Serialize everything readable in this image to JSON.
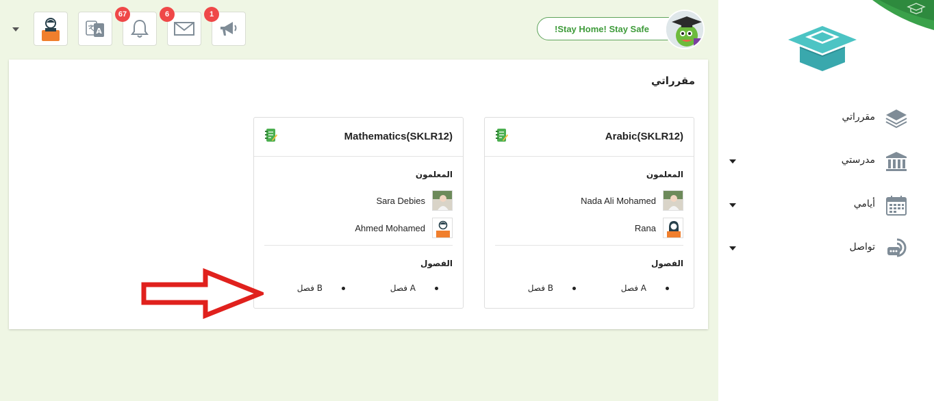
{
  "header": {
    "badges": {
      "notifications": "67",
      "messages": "6",
      "announcements": "1"
    },
    "stay_home": "!Stay Home! Stay Safe"
  },
  "main": {
    "title": "مقرراتي",
    "courses": [
      {
        "title": "Arabic(SKLR12)",
        "teachers_label": "المعلمون",
        "teachers": [
          {
            "name": "Nada Ali Mohamed"
          },
          {
            "name": "Rana"
          }
        ],
        "classes_label": "الفصول",
        "classes": [
          "فصل A",
          "فصل B"
        ]
      },
      {
        "title": "Mathematics(SKLR12)",
        "teachers_label": "المعلمون",
        "teachers": [
          {
            "name": "Sara Debies"
          },
          {
            "name": "Ahmed Mohamed"
          }
        ],
        "classes_label": "الفصول",
        "classes": [
          "فصل A",
          "فصل B"
        ]
      }
    ]
  },
  "sidebar": {
    "items": [
      {
        "label": "مقرراتي",
        "icon": "layers-icon"
      },
      {
        "label": "مدرستي",
        "icon": "school-icon"
      },
      {
        "label": "أيامي",
        "icon": "calendar-icon"
      },
      {
        "label": "تواصل",
        "icon": "chat-icon"
      }
    ]
  },
  "colors": {
    "background": "#eff6e4",
    "accent_green": "#3e9b3a",
    "badge_red": "#ef4848",
    "arrow_red": "#e0211d",
    "icon_gray": "#7f8c97"
  }
}
